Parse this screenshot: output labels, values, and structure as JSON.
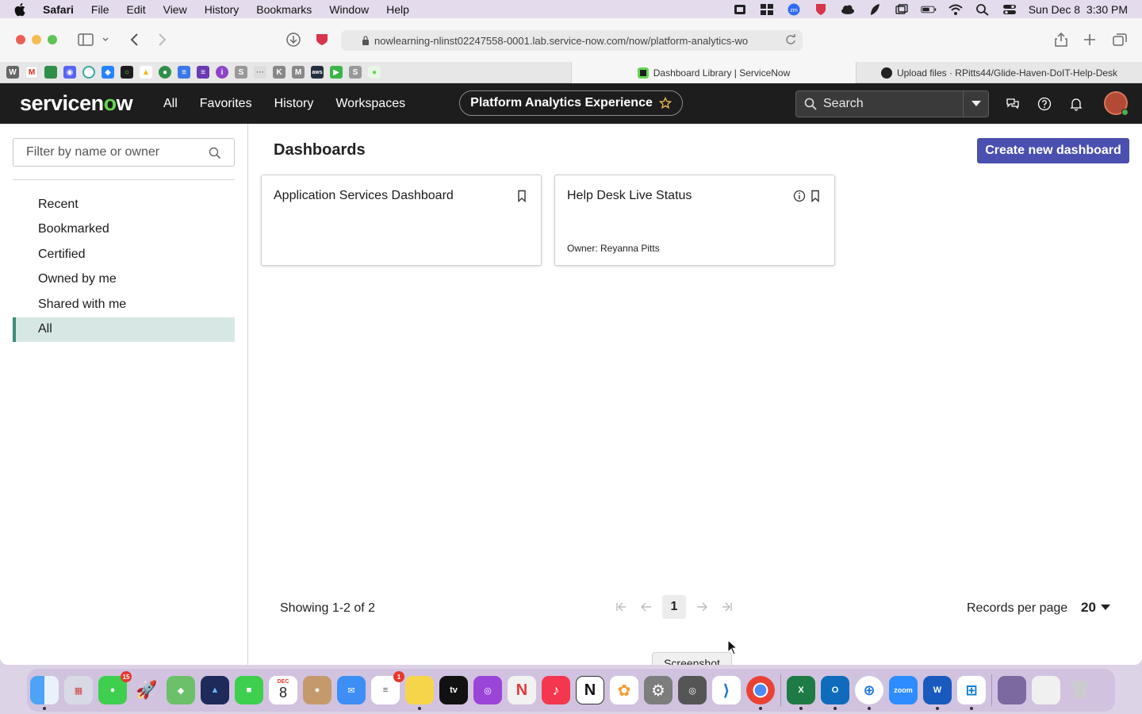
{
  "menubar": {
    "app": "Safari",
    "items": [
      "File",
      "Edit",
      "View",
      "History",
      "Bookmarks",
      "Window",
      "Help"
    ],
    "clock": "Sun Dec 8  3:30 PM"
  },
  "browser": {
    "url": "nowlearning-nlinst02247558-0001.lab.service-now.com/now/platform-analytics-wo",
    "tabs": [
      {
        "label": "Dashboard Library | ServiceNow",
        "active": true
      },
      {
        "label": "Upload files · RPitts44/Glide-Haven-DoIT-Help-Desk",
        "active": false
      }
    ]
  },
  "sn_header": {
    "logo": "servicenow",
    "nav": [
      "All",
      "Favorites",
      "History",
      "Workspaces"
    ],
    "pill": "Platform Analytics Experience",
    "search_placeholder": "Search"
  },
  "sidebar": {
    "filter_placeholder": "Filter by name or owner",
    "items": [
      {
        "label": "Recent"
      },
      {
        "label": "Bookmarked"
      },
      {
        "label": "Certified"
      },
      {
        "label": "Owned by me"
      },
      {
        "label": "Shared with me"
      },
      {
        "label": "All",
        "selected": true
      }
    ]
  },
  "main": {
    "title": "Dashboards",
    "create_button": "Create new dashboard",
    "cards": [
      {
        "title": "Application Services Dashboard",
        "owner": ""
      },
      {
        "title": "Help Desk Live Status",
        "owner": "Owner: Reyanna Pitts"
      }
    ],
    "showing": "Showing 1-2 of 2",
    "page": "1",
    "records_label": "Records per page",
    "records_value": "20",
    "tooltip": "Screenshot"
  },
  "dock": {
    "messages_badge": "15",
    "reminders_badge": "1",
    "calendar_month": "DEC",
    "calendar_day": "8"
  },
  "colors": {
    "sn_header_bg": "#1d1d1d",
    "accent_button": "#4b4fb0",
    "selected_nav_bg": "#d7e8e4",
    "selected_nav_border": "#3b8c7d"
  }
}
